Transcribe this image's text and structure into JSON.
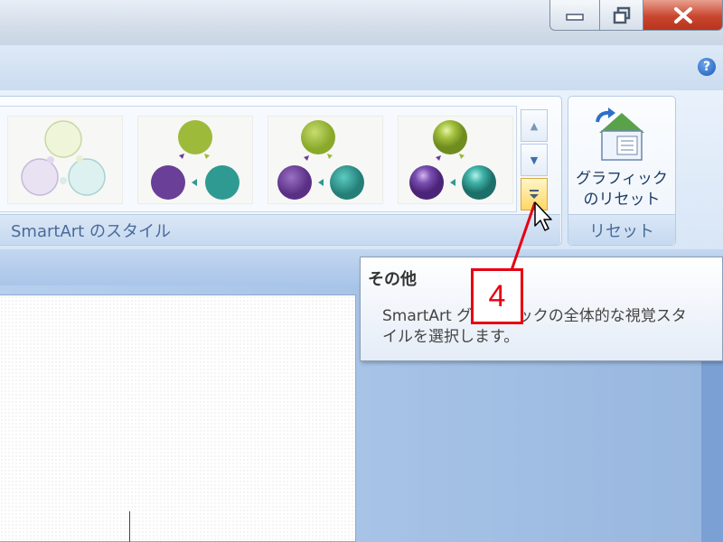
{
  "window": {
    "minimize_icon": "minimize-icon",
    "maximize_icon": "restore-icon",
    "close_icon": "close-icon"
  },
  "ribbon": {
    "help_label": "?",
    "styles_group": {
      "label": "SmartArt のスタイル",
      "thumbnails": [
        {
          "name": "style-white-outline"
        },
        {
          "name": "style-flat"
        },
        {
          "name": "style-subtle"
        },
        {
          "name": "style-polished"
        }
      ],
      "scroll_up_icon": "scroll-up-icon",
      "scroll_down_icon": "scroll-down-icon",
      "more_icon": "more-icon"
    },
    "reset_group": {
      "button_label_line1": "グラフィック",
      "button_label_line2": "のリセット",
      "label": "リセット"
    }
  },
  "tooltip": {
    "title": "その他",
    "description": "SmartArt グラフィックの全体的な視覚スタイルを選択します。"
  },
  "callout": {
    "number": "4",
    "color": "#e60012"
  }
}
